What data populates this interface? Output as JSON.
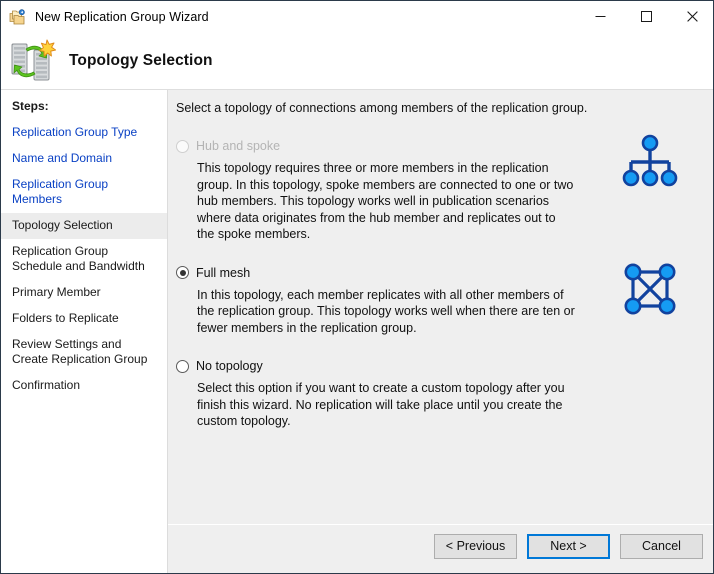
{
  "window": {
    "title": "New Replication Group Wizard",
    "icon": "replication-folders-icon",
    "caption_buttons": [
      {
        "name": "minimize",
        "glyph": "—"
      },
      {
        "name": "maximize",
        "glyph": "☐"
      },
      {
        "name": "close",
        "glyph": "✕"
      }
    ]
  },
  "header": {
    "title": "Topology Selection",
    "icon": "server-replication-icon"
  },
  "sidebar": {
    "label": "Steps:",
    "items": [
      {
        "label": "Replication Group Type",
        "state": "completed"
      },
      {
        "label": "Name and Domain",
        "state": "completed"
      },
      {
        "label": "Replication Group Members",
        "state": "completed"
      },
      {
        "label": "Topology Selection",
        "state": "current"
      },
      {
        "label": "Replication Group Schedule and Bandwidth",
        "state": "pending"
      },
      {
        "label": "Primary Member",
        "state": "pending"
      },
      {
        "label": "Folders to Replicate",
        "state": "pending"
      },
      {
        "label": "Review Settings and Create Replication Group",
        "state": "pending"
      },
      {
        "label": "Confirmation",
        "state": "pending"
      }
    ]
  },
  "main": {
    "instruction": "Select a topology of connections among members of the replication group.",
    "options": [
      {
        "label": "Hub and spoke",
        "description": "This topology requires three or more members in the replication group. In this topology, spoke members are connected to one or two hub members. This topology works well in publication scenarios where data originates from the hub member and replicates out to the spoke members.",
        "selected": false,
        "disabled": true,
        "diagram": "hub-and-spoke-diagram"
      },
      {
        "label": "Full mesh",
        "description": "In this topology, each member replicates with all other members of the replication group. This topology works well when there are ten or fewer members in the replication group.",
        "selected": true,
        "disabled": false,
        "diagram": "full-mesh-diagram"
      },
      {
        "label": "No topology",
        "description": "Select this option if you want to create a custom topology after you finish this wizard. No replication will take place until you create the custom topology.",
        "selected": false,
        "disabled": false,
        "diagram": null
      }
    ]
  },
  "footer": {
    "previous_label": "< Previous",
    "next_label": "Next >",
    "cancel_label": "Cancel",
    "default_button": "next"
  },
  "colors": {
    "node_fill": "#159bf3",
    "node_stroke": "#11429e",
    "edge": "#11429e",
    "content_bg": "#efefef",
    "sidebar_bg": "#ffffff",
    "link": "#0a41c4",
    "accent": "#0078d7"
  }
}
